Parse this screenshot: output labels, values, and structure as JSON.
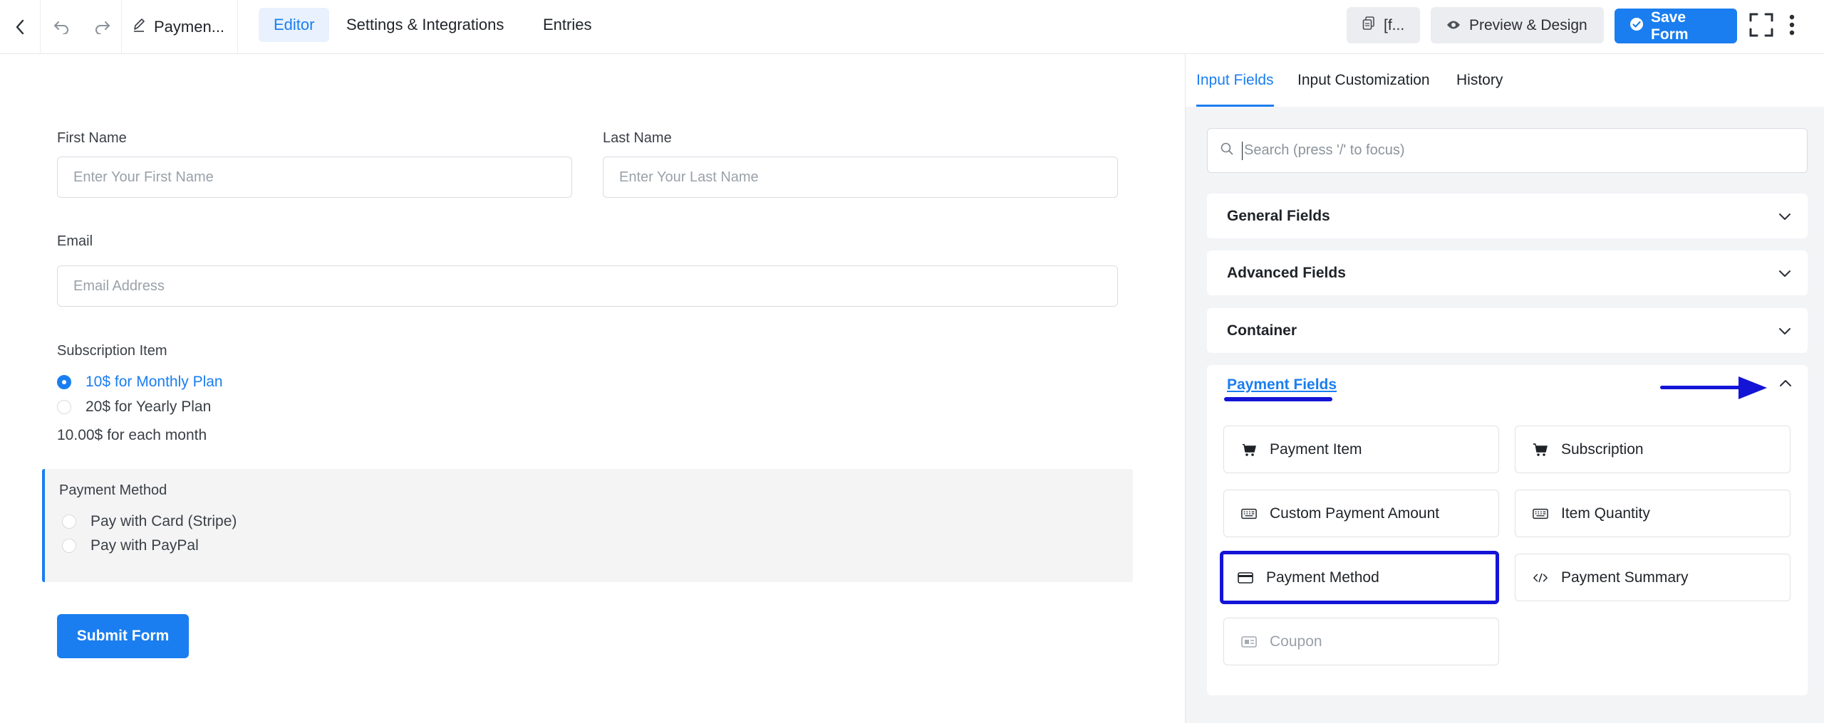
{
  "topbar": {
    "form_title": "Paymen...",
    "tabs": [
      {
        "label": "Editor",
        "active": true
      },
      {
        "label": "Settings & Integrations",
        "active": false
      },
      {
        "label": "Entries",
        "active": false
      }
    ],
    "shortcode_label": "[f...",
    "preview_label": "Preview & Design",
    "save_label": "Save Form"
  },
  "form": {
    "first_name": {
      "label": "First Name",
      "placeholder": "Enter Your First Name"
    },
    "last_name": {
      "label": "Last Name",
      "placeholder": "Enter Your Last Name"
    },
    "email": {
      "label": "Email",
      "placeholder": "Email Address"
    },
    "subscription": {
      "label": "Subscription Item",
      "options": [
        {
          "label": "10$ for Monthly Plan",
          "selected": true
        },
        {
          "label": "20$ for Yearly Plan",
          "selected": false
        }
      ],
      "summary": "10.00$ for each month"
    },
    "payment_method": {
      "label": "Payment Method",
      "options": [
        {
          "label": "Pay with Card (Stripe)"
        },
        {
          "label": "Pay with PayPal"
        }
      ]
    },
    "submit_label": "Submit Form"
  },
  "panel": {
    "tabs": [
      {
        "label": "Input Fields",
        "active": true
      },
      {
        "label": "Input Customization",
        "active": false
      },
      {
        "label": "History",
        "active": false
      }
    ],
    "search_placeholder": "Search (press '/' to focus)",
    "sections": [
      {
        "label": "General Fields"
      },
      {
        "label": "Advanced Fields"
      },
      {
        "label": "Container"
      }
    ],
    "payment_section": {
      "label": "Payment Fields",
      "items": [
        {
          "label": "Payment Item",
          "icon": "cart-icon"
        },
        {
          "label": "Subscription",
          "icon": "cart-icon"
        },
        {
          "label": "Custom Payment Amount",
          "icon": "keyboard-icon"
        },
        {
          "label": "Item Quantity",
          "icon": "keyboard-icon"
        },
        {
          "label": "Payment Method",
          "icon": "credit-card-icon"
        },
        {
          "label": "Payment Summary",
          "icon": "code-icon"
        },
        {
          "label": "Coupon",
          "icon": "coupon-icon"
        }
      ]
    }
  },
  "colors": {
    "accent": "#1a7ef0",
    "highlight_annotation": "#1414d6",
    "panel_bg": "#f3f4f6"
  }
}
